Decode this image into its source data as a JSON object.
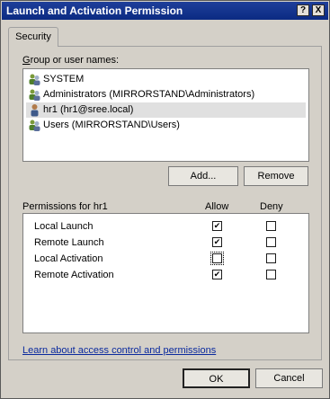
{
  "window": {
    "title": "Launch and Activation Permission",
    "help_button": "?",
    "close_button": "X"
  },
  "tabs": [
    {
      "label": "Security"
    }
  ],
  "group_label": "Group or user names:",
  "users": [
    {
      "name": "SYSTEM",
      "icon": "group-users-icon",
      "selected": false
    },
    {
      "name": "Administrators (MIRRORSTAND\\Administrators)",
      "icon": "group-users-icon",
      "selected": false
    },
    {
      "name": "hr1 (hr1@sree.local)",
      "icon": "single-user-icon",
      "selected": true
    },
    {
      "name": "Users (MIRRORSTAND\\Users)",
      "icon": "group-users-icon",
      "selected": false
    }
  ],
  "buttons": {
    "add": "Add...",
    "remove": "Remove",
    "ok": "OK",
    "cancel": "Cancel"
  },
  "permissions": {
    "label": "Permissions for hr1",
    "allow_header": "Allow",
    "deny_header": "Deny",
    "items": [
      {
        "name": "Local Launch",
        "allow": true,
        "deny": false
      },
      {
        "name": "Remote Launch",
        "allow": true,
        "deny": false
      },
      {
        "name": "Local Activation",
        "allow": false,
        "deny": false
      },
      {
        "name": "Remote Activation",
        "allow": true,
        "deny": false
      }
    ]
  },
  "link_text": "Learn about access control and permissions"
}
